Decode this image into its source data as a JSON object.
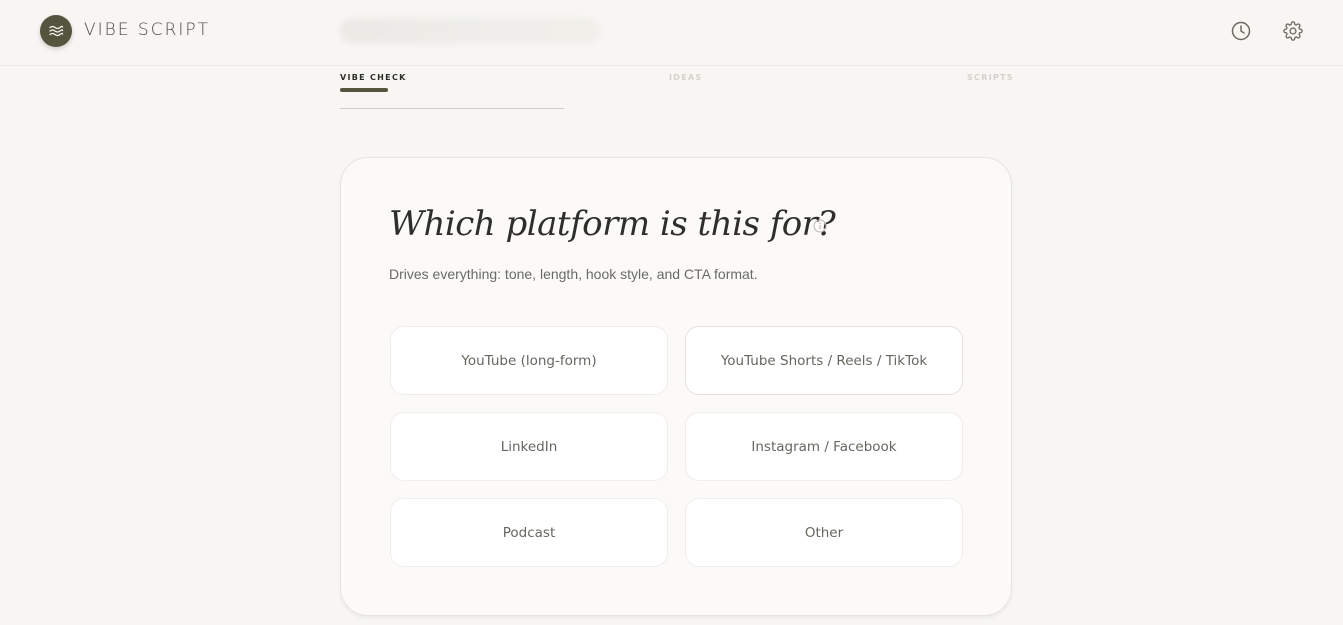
{
  "header": {
    "brand": "VIBE SCRIPT",
    "logo_icon": "waves-icon",
    "history_icon": "clock-icon",
    "settings_icon": "gear-icon"
  },
  "steps": [
    {
      "label": "VIBE CHECK",
      "active": true
    },
    {
      "label": "IDEAS",
      "active": false
    },
    {
      "label": "SCRIPTS",
      "active": false
    }
  ],
  "question": {
    "title": "Which platform is this for?",
    "subtitle": "Drives everything: tone, length, hook style, and CTA format.",
    "info_icon": "info-icon"
  },
  "options": [
    {
      "label": "YouTube (long-form)"
    },
    {
      "label": "YouTube Shorts / Reels / TikTok"
    },
    {
      "label": "LinkedIn"
    },
    {
      "label": "Instagram / Facebook"
    },
    {
      "label": "Podcast"
    },
    {
      "label": "Other"
    }
  ],
  "colors": {
    "accent": "#55553f",
    "background": "#f7f6f3",
    "card": "#fbfaf9"
  }
}
